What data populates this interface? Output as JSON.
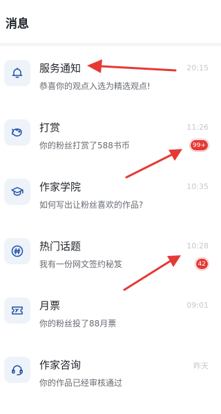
{
  "header": {
    "title": "消息"
  },
  "items": [
    {
      "icon": "bell-icon",
      "title": "服务通知",
      "subtitle": "恭喜你的观点入选为精选观点!",
      "time": "20:15",
      "badge": ""
    },
    {
      "icon": "piggy-bank-icon",
      "title": "打赏",
      "subtitle": "你的粉丝打赏了588书币",
      "time": "11:26",
      "badge": "99+"
    },
    {
      "icon": "graduation-cap-icon",
      "title": "作家学院",
      "subtitle": "如何写出让粉丝喜欢的作品?",
      "time": "10:35",
      "badge": ""
    },
    {
      "icon": "hashtag-icon",
      "title": "热门话题",
      "subtitle": "我有一份网文签约秘笈",
      "time": "10:28",
      "badge": "42"
    },
    {
      "icon": "ticket-icon",
      "title": "月票",
      "subtitle": "你的粉丝投了88月票",
      "time": "09:01",
      "badge": ""
    },
    {
      "icon": "headset-icon",
      "title": "作家咨询",
      "subtitle": "你的作品已经审核通过",
      "time": "昨天",
      "badge": ""
    }
  ],
  "colors": {
    "icon_stroke": "#1c4fa8",
    "icon_bg": "#eef3fa",
    "badge": "#e53935",
    "annotation_arrow": "#e53935"
  }
}
